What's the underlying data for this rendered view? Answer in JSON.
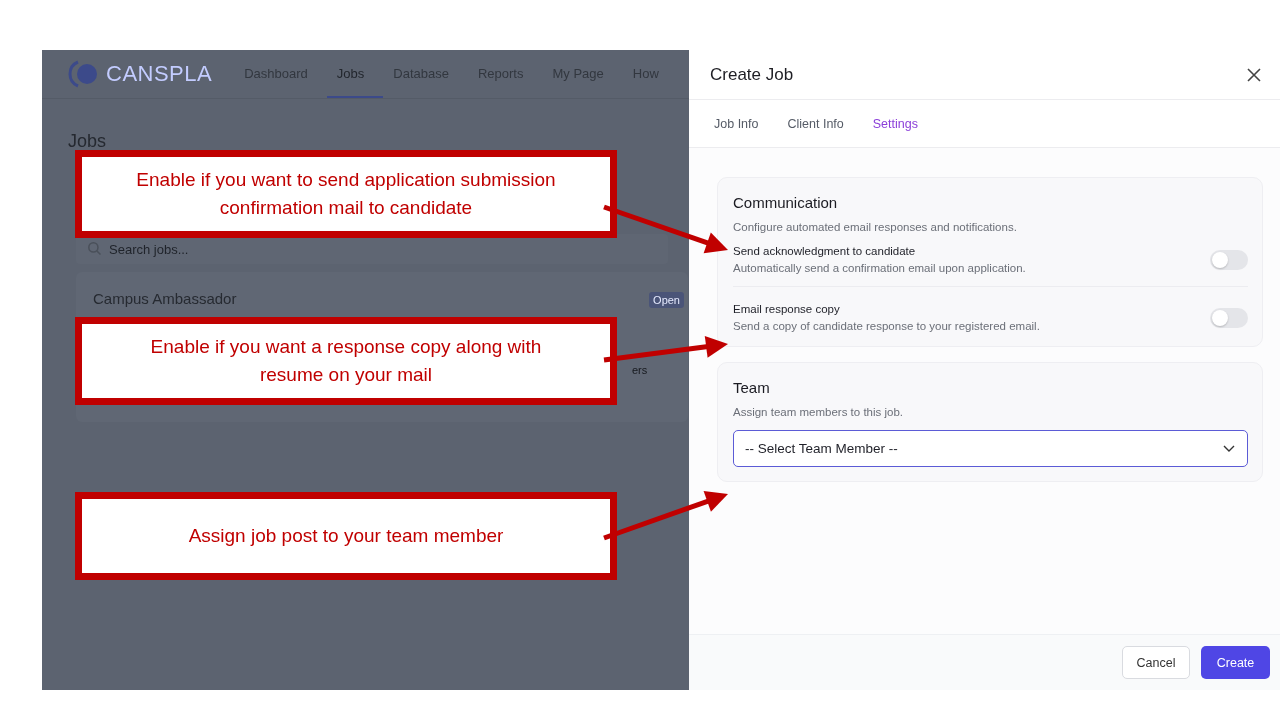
{
  "app": {
    "logo": "CANSPLA",
    "nav": [
      {
        "label": "Dashboard",
        "selected": false
      },
      {
        "label": "Jobs",
        "selected": true
      },
      {
        "label": "Database",
        "selected": false
      },
      {
        "label": "Reports",
        "selected": false
      },
      {
        "label": "My Page",
        "selected": false
      },
      {
        "label": "How",
        "selected": false
      }
    ],
    "page_title": "Jobs",
    "search": {
      "placeholder": "Search jobs..."
    },
    "job_card": {
      "title": "Campus Ambassador",
      "status": "Open",
      "fragment": "ers"
    }
  },
  "dialog": {
    "title": "Create Job",
    "tabs": [
      {
        "label": "Job Info",
        "selected": false
      },
      {
        "label": "Client Info",
        "selected": false
      },
      {
        "label": "Settings",
        "selected": true
      }
    ],
    "sections": [
      {
        "kind": "toggles",
        "title": "Communication",
        "description": "Configure automated email responses and notifications.",
        "settings": [
          {
            "label": "Send acknowledgment to candidate",
            "description": "Automatically send a confirmation email upon application.",
            "on": false
          },
          {
            "label": "Email response copy",
            "description": "Send a copy of candidate response to your registered email.",
            "on": false
          }
        ]
      },
      {
        "kind": "select",
        "title": "Team",
        "description": "Assign team members to this job.",
        "select": {
          "value": "-- Select Team Member --"
        }
      }
    ],
    "buttons": [
      {
        "label": "Cancel",
        "kind": "secondary"
      },
      {
        "label": "Create",
        "kind": "primary"
      }
    ]
  },
  "callouts": [
    {
      "text": "Enable if you want to send application submission confirmation mail to candidate"
    },
    {
      "text": "Enable if you want a response copy along with resume on your mail"
    },
    {
      "text": "Assign job post to your team member"
    }
  ]
}
